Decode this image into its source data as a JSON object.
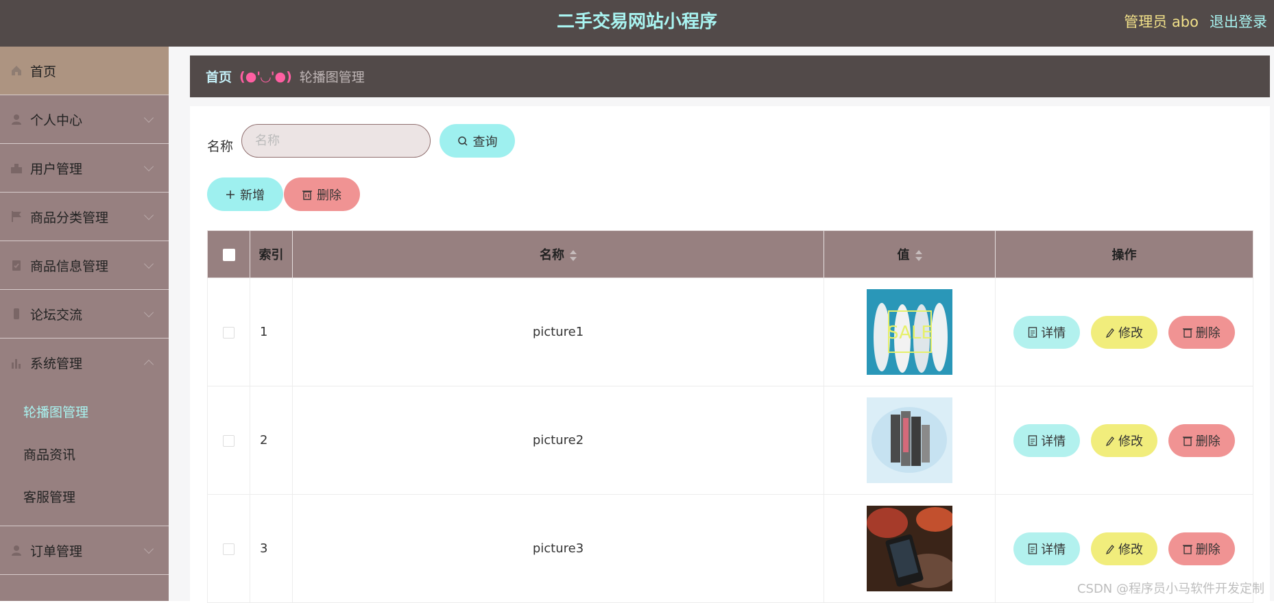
{
  "header": {
    "title": "二手交易网站小程序",
    "admin_label": "管理员 abo",
    "logout_label": "退出登录"
  },
  "sidebar": {
    "items": [
      {
        "label": "首页",
        "icon": "home-icon"
      },
      {
        "label": "个人中心",
        "icon": "user-icon"
      },
      {
        "label": "用户管理",
        "icon": "users-icon"
      },
      {
        "label": "商品分类管理",
        "icon": "flag-icon"
      },
      {
        "label": "商品信息管理",
        "icon": "clipboard-icon"
      },
      {
        "label": "论坛交流",
        "icon": "phone-icon"
      },
      {
        "label": "系统管理",
        "icon": "chart-icon"
      }
    ],
    "sub_items": [
      {
        "label": "轮播图管理"
      },
      {
        "label": "商品资讯"
      },
      {
        "label": "客服管理"
      }
    ],
    "last_item": {
      "label": "订单管理",
      "icon": "user-icon"
    }
  },
  "breadcrumb": {
    "home": "首页",
    "separator": "(●'◡'●)",
    "current": "轮播图管理"
  },
  "search": {
    "label": "名称",
    "placeholder": "名称",
    "button_label": "查询"
  },
  "actions": {
    "add_label": "新增",
    "delete_label": "删除"
  },
  "table": {
    "headers": {
      "index": "索引",
      "name": "名称",
      "value": "值",
      "ops": "操作"
    },
    "rows": [
      {
        "index": "1",
        "name": "picture1",
        "image": "sale-banner"
      },
      {
        "index": "2",
        "name": "picture2",
        "image": "phones-banner"
      },
      {
        "index": "3",
        "name": "picture3",
        "image": "phone-photo"
      }
    ],
    "op_labels": {
      "detail": "详情",
      "edit": "修改",
      "delete": "删除"
    }
  },
  "watermark": "CSDN @程序员小马软件开发定制",
  "colors": {
    "header_bg": "#524a49",
    "sidebar_bg": "#978080",
    "accent_cyan": "#9ef0ef",
    "accent_red": "#f09393",
    "accent_yellow": "#f1ed7c"
  }
}
